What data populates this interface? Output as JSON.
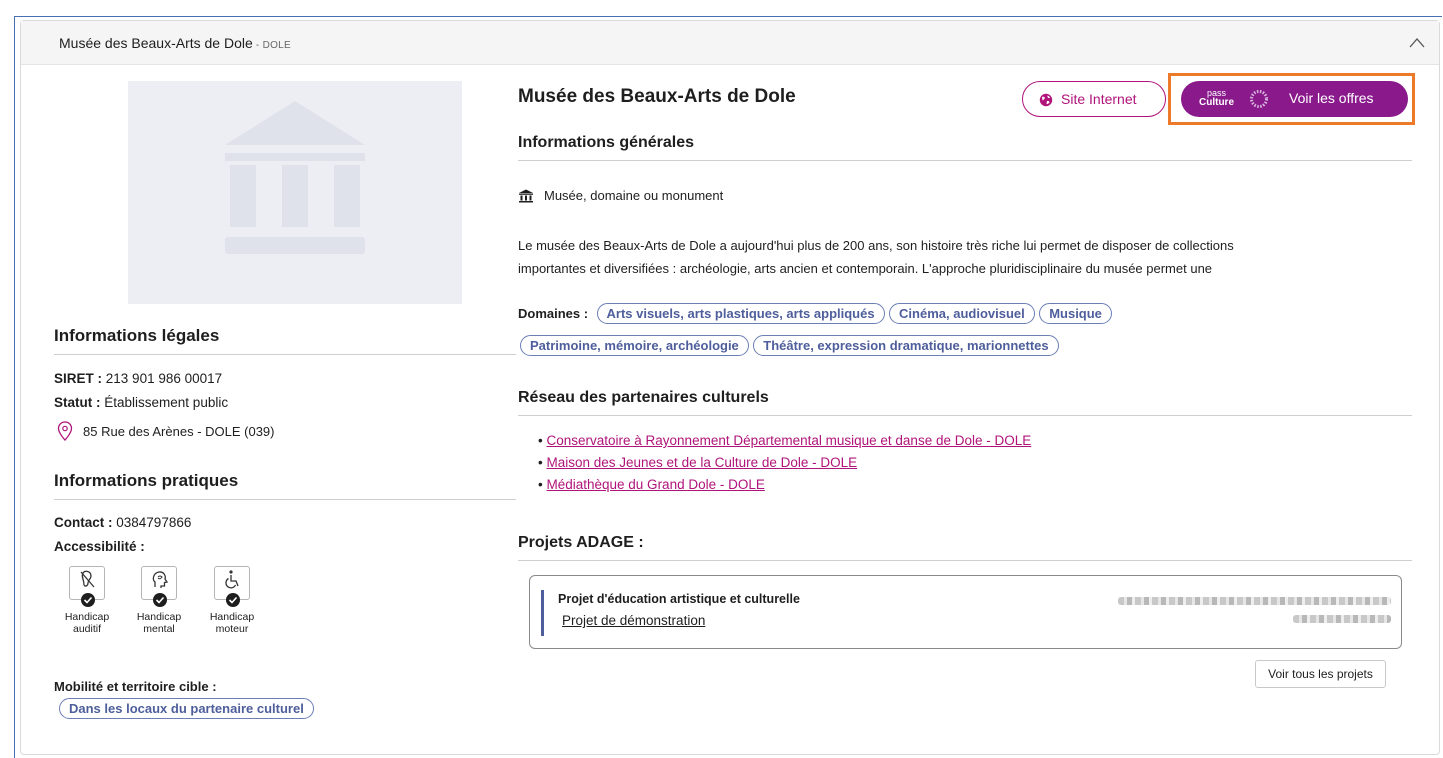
{
  "header": {
    "title": "Musée des Beaux-Arts de Dole",
    "separator": " - ",
    "city": "DOLE",
    "collapse_icon": "chevron-up-icon"
  },
  "left": {
    "image_icon": "museum-building-icon",
    "legal": {
      "heading": "Informations légales",
      "siret_label": "SIRET :",
      "siret_value": "213 901 986 00017",
      "status_label": "Statut :",
      "status_value": "Établissement public",
      "address": "85 Rue des Arènes - DOLE (039)",
      "address_icon": "map-pin-icon"
    },
    "practical": {
      "heading": "Informations pratiques",
      "contact_label": "Contact :",
      "contact_value": "0384797866",
      "accessibility_label": "Accessibilité :",
      "accessibility": [
        {
          "icon": "deaf-ear-icon",
          "line1": "Handicap",
          "line2": "auditif"
        },
        {
          "icon": "mental-head-icon",
          "line1": "Handicap",
          "line2": "mental"
        },
        {
          "icon": "wheelchair-icon",
          "line1": "Handicap",
          "line2": "moteur"
        }
      ],
      "mobility_label": "Mobilité et territoire cible :",
      "mobility_tag": "Dans les locaux du partenaire culturel"
    }
  },
  "right": {
    "title": "Musée des Beaux-Arts de Dole",
    "site_button": "Site Internet",
    "site_icon": "globe-icon",
    "offers_logo_top": "pass",
    "offers_logo_bottom": "Culture",
    "offers_button": "Voir les offres",
    "general": {
      "heading": "Informations générales",
      "type": "Musée, domaine ou monument",
      "type_icon": "museum-icon",
      "description_line1": "Le musée des Beaux-Arts de Dole a aujourd'hui plus de 200 ans, son histoire très riche lui permet de disposer de collections",
      "description_line2": "importantes et diversifiées : archéologie, arts ancien et contemporain. L'approche pluridisciplinaire du musée permet une"
    },
    "domains_label": "Domaines :",
    "domains": [
      "Arts visuels, arts plastiques, arts appliqués",
      "Cinéma, audiovisuel",
      "Musique",
      "Patrimoine, mémoire, archéologie",
      "Théâtre, expression dramatique, marionnettes"
    ],
    "network": {
      "heading": "Réseau des partenaires culturels",
      "links": [
        "Conservatoire à Rayonnement Départemental musique et danse de Dole - DOLE",
        "Maison des Jeunes et de la Culture de Dole - DOLE",
        "Médiathèque du Grand Dole - DOLE"
      ]
    },
    "projects": {
      "heading": "Projets ADAGE :",
      "card_title": "Projet d'éducation artistique et culturelle",
      "card_link": "Projet de démonstration",
      "all_button": "Voir tous les projets"
    }
  },
  "colors": {
    "accent": "#b0147a",
    "brand_purple": "#8a1a8c",
    "tag_blue": "#4e5e9c",
    "highlight_orange": "#ec7a2a"
  }
}
